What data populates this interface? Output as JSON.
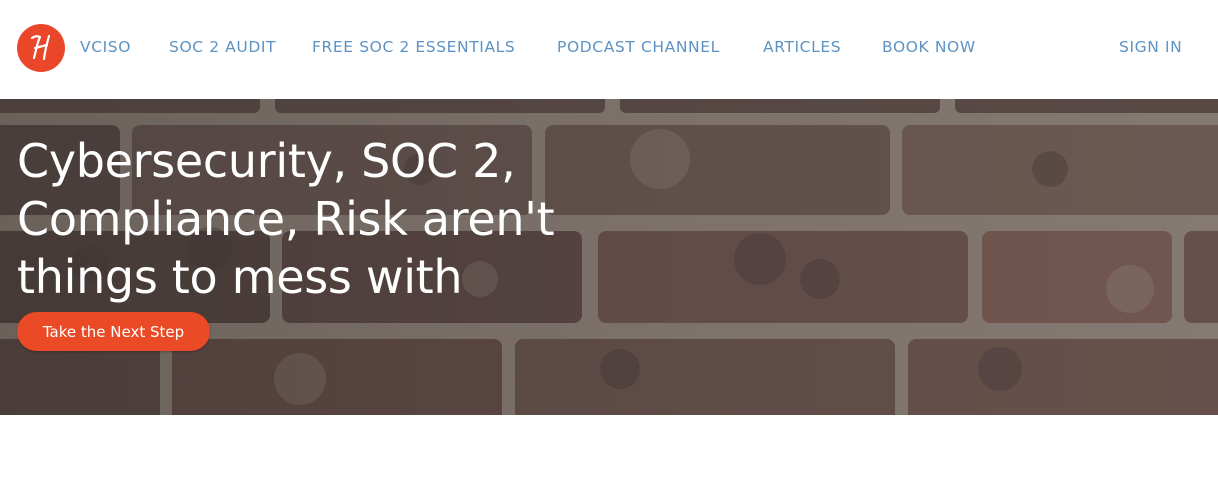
{
  "brand": {
    "logo_icon": "script-h-logo-icon",
    "logo_letter": "H",
    "accent_color": "#e9462a"
  },
  "nav": {
    "items": [
      {
        "label": "VCISO"
      },
      {
        "label": "SOC 2 AUDIT"
      },
      {
        "label": "FREE SOC 2 ESSENTIALS"
      },
      {
        "label": "PODCAST CHANNEL"
      },
      {
        "label": "ARTICLES"
      },
      {
        "label": "BOOK NOW"
      }
    ],
    "sign_in": "SIGN IN",
    "link_color": "#5d93c4"
  },
  "hero": {
    "background": "brick-wall-photo",
    "title_lines": [
      "Cybersecurity, SOC 2,",
      "Compliance, Risk aren't",
      "things to mess with"
    ],
    "cta_label": "Take the Next Step",
    "cta_color": "#ea4a25"
  }
}
